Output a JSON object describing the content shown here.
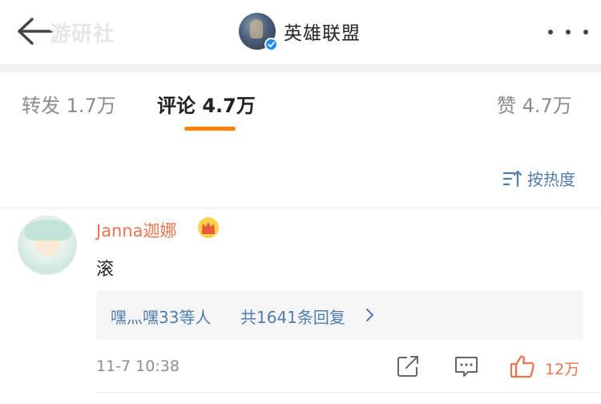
{
  "header": {
    "back_icon": "arrow-left-icon",
    "watermark": "游研社",
    "account_name": "英雄联盟",
    "verified_icon": "verified-badge-icon",
    "more_icon": "more-dots-icon"
  },
  "tabs": [
    {
      "label": "转发 1.7万",
      "active": false
    },
    {
      "label": "评论 4.7万",
      "active": true
    },
    {
      "label": "赞 4.7万",
      "active": false
    }
  ],
  "sort": {
    "icon": "sort-icon",
    "label": "按热度"
  },
  "comment": {
    "username": "Janna迦娜",
    "badge_icon": "crown-icon",
    "text": "滚",
    "replies_names": "嘿灬嘿33等人",
    "replies_count": "共1641条回复",
    "time": "11-7 10:38",
    "like_count": "12万"
  },
  "colors": {
    "accent_orange": "#ff8200",
    "link_blue": "#507daf",
    "username_orange": "#eb7350"
  }
}
